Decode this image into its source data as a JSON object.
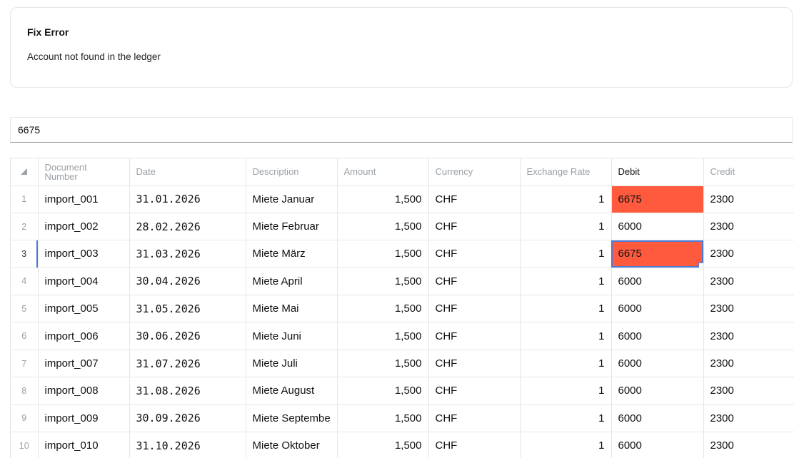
{
  "error_card": {
    "title": "Fix Error",
    "message": "Account not found in the ledger"
  },
  "edit_bar": {
    "value": "6675"
  },
  "table": {
    "columns": [
      "Document Number",
      "Date",
      "Description",
      "Amount",
      "Currency",
      "Exchange Rate",
      "Debit",
      "Credit"
    ],
    "active_column": "Debit",
    "rows": [
      {
        "n": "1",
        "doc": "import_001",
        "date": "31.01.2026",
        "desc": "Miete Januar",
        "amount": "1,500",
        "currency": "CHF",
        "rate": "1",
        "debit": "6675",
        "credit": "2300"
      },
      {
        "n": "2",
        "doc": "import_002",
        "date": "28.02.2026",
        "desc": "Miete Februar",
        "amount": "1,500",
        "currency": "CHF",
        "rate": "1",
        "debit": "6000",
        "credit": "2300"
      },
      {
        "n": "3",
        "doc": "import_003",
        "date": "31.03.2026",
        "desc": "Miete März",
        "amount": "1,500",
        "currency": "CHF",
        "rate": "1",
        "debit": "6675",
        "credit": "2300"
      },
      {
        "n": "4",
        "doc": "import_004",
        "date": "30.04.2026",
        "desc": "Miete April",
        "amount": "1,500",
        "currency": "CHF",
        "rate": "1",
        "debit": "6000",
        "credit": "2300"
      },
      {
        "n": "5",
        "doc": "import_005",
        "date": "31.05.2026",
        "desc": "Miete Mai",
        "amount": "1,500",
        "currency": "CHF",
        "rate": "1",
        "debit": "6000",
        "credit": "2300"
      },
      {
        "n": "6",
        "doc": "import_006",
        "date": "30.06.2026",
        "desc": "Miete Juni",
        "amount": "1,500",
        "currency": "CHF",
        "rate": "1",
        "debit": "6000",
        "credit": "2300"
      },
      {
        "n": "7",
        "doc": "import_007",
        "date": "31.07.2026",
        "desc": "Miete Juli",
        "amount": "1,500",
        "currency": "CHF",
        "rate": "1",
        "debit": "6000",
        "credit": "2300"
      },
      {
        "n": "8",
        "doc": "import_008",
        "date": "31.08.2026",
        "desc": "Miete August",
        "amount": "1,500",
        "currency": "CHF",
        "rate": "1",
        "debit": "6000",
        "credit": "2300"
      },
      {
        "n": "9",
        "doc": "import_009",
        "date": "30.09.2026",
        "desc": "Miete Septembe",
        "amount": "1,500",
        "currency": "CHF",
        "rate": "1",
        "debit": "6000",
        "credit": "2300"
      },
      {
        "n": "10",
        "doc": "import_010",
        "date": "31.10.2026",
        "desc": "Miete Oktober",
        "amount": "1,500",
        "currency": "CHF",
        "rate": "1",
        "debit": "6000",
        "credit": "2300"
      }
    ]
  },
  "colors": {
    "error_cell": "#ff5a3d",
    "selection": "#4a7bd6"
  }
}
